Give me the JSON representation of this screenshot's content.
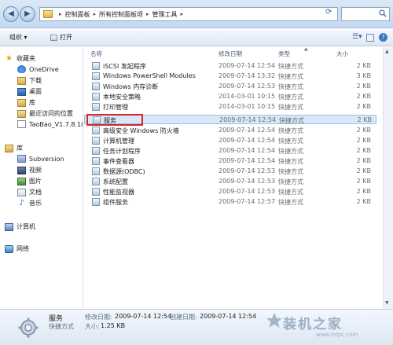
{
  "address": {
    "crumbs": [
      "控制面板",
      "所有控制面板项",
      "管理工具"
    ]
  },
  "toolbar": {
    "organize_label": "组织 ▾",
    "open_label": "打开"
  },
  "sidebar": {
    "favorites": "收藏夹",
    "onedrive": "OneDrive",
    "downloads": "下载",
    "desktop": "桌面",
    "library_short": "库",
    "recent": "最近访问的位置",
    "taobao": "TaoBao_V1.7.8.10_",
    "library": "库",
    "subversion": "Subversion",
    "videos": "视频",
    "pictures": "图片",
    "documents": "文档",
    "music": "音乐",
    "computer": "计算机",
    "network": "网络"
  },
  "columns": {
    "name": "名称",
    "date": "修改日期",
    "type": "类型",
    "size": "大小"
  },
  "files": [
    {
      "name": "iSCSI 发起程序",
      "date": "2009-07-14 12:54",
      "type": "快捷方式",
      "size": "2 KB"
    },
    {
      "name": "Windows PowerShell Modules",
      "date": "2009-07-14 13:32",
      "type": "快捷方式",
      "size": "3 KB"
    },
    {
      "name": "Windows 内存诊断",
      "date": "2009-07-14 12:53",
      "type": "快捷方式",
      "size": "2 KB"
    },
    {
      "name": "本地安全策略",
      "date": "2014-03-01 10:15",
      "type": "快捷方式",
      "size": "2 KB"
    },
    {
      "name": "打印管理",
      "date": "2014-03-01 10:15",
      "type": "快捷方式",
      "size": "2 KB"
    },
    {
      "name": "服务",
      "date": "2009-07-14 12:54",
      "type": "快捷方式",
      "size": "2 KB"
    },
    {
      "name": "高级安全 Windows 防火墙",
      "date": "2009-07-14 12:54",
      "type": "快捷方式",
      "size": "2 KB"
    },
    {
      "name": "计算机管理",
      "date": "2009-07-14 12:54",
      "type": "快捷方式",
      "size": "2 KB"
    },
    {
      "name": "任务计划程序",
      "date": "2009-07-14 12:54",
      "type": "快捷方式",
      "size": "2 KB"
    },
    {
      "name": "事件查看器",
      "date": "2009-07-14 12:54",
      "type": "快捷方式",
      "size": "2 KB"
    },
    {
      "name": "数据源(ODBC)",
      "date": "2009-07-14 12:53",
      "type": "快捷方式",
      "size": "2 KB"
    },
    {
      "name": "系统配置",
      "date": "2009-07-14 12:53",
      "type": "快捷方式",
      "size": "2 KB"
    },
    {
      "name": "性能监视器",
      "date": "2009-07-14 12:53",
      "type": "快捷方式",
      "size": "2 KB"
    },
    {
      "name": "组件服务",
      "date": "2009-07-14 12:57",
      "type": "快捷方式",
      "size": "2 KB"
    }
  ],
  "details": {
    "name": "服务",
    "modified_label": "修改日期:",
    "modified": "2009-07-14 12:54",
    "created_label": "创建日期:",
    "created": "2009-07-14 12:54",
    "type": "快捷方式",
    "size_label": "大小:",
    "size": "1.25 KB"
  },
  "watermark": {
    "title": "装机之家",
    "url": "www.lotpc.com"
  },
  "colors": {
    "highlight_box": "#d8262a",
    "selected_row": "#d8e8f8"
  }
}
